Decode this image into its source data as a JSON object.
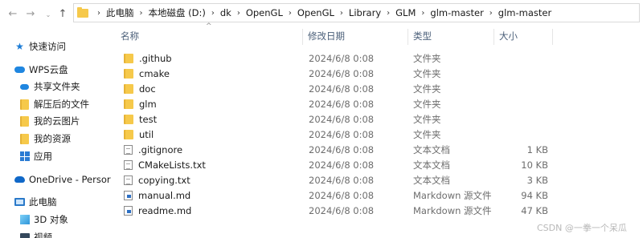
{
  "address_bar": {
    "breadcrumbs": [
      "此电脑",
      "本地磁盘 (D:)",
      "dk",
      "OpenGL",
      "OpenGL",
      "Library",
      "GLM",
      "glm-master",
      "glm-master"
    ]
  },
  "sidebar": {
    "items": [
      {
        "label": "快速访问",
        "icon": "star-icon"
      },
      {
        "label": "WPS云盘",
        "icon": "cloud-icon"
      },
      {
        "label": "共享文件夹",
        "icon": "folder-icon"
      },
      {
        "label": "解压后的文件",
        "icon": "folder-icon"
      },
      {
        "label": "我的云图片",
        "icon": "folder-icon"
      },
      {
        "label": "我的资源",
        "icon": "folder-icon"
      },
      {
        "label": "应用",
        "icon": "apps-icon"
      },
      {
        "label": "OneDrive - Persor",
        "icon": "onedrive-icon"
      },
      {
        "label": "此电脑",
        "icon": "pc-icon"
      },
      {
        "label": "3D 对象",
        "icon": "3d-objects-icon"
      },
      {
        "label": "视频",
        "icon": "video-icon"
      }
    ]
  },
  "columns": {
    "name": "名称",
    "modified": "修改日期",
    "type": "类型",
    "size": "大小"
  },
  "files": [
    {
      "name": ".github",
      "modified": "2024/6/8 0:08",
      "type": "文件夹",
      "size": "",
      "icon": "folder-icon"
    },
    {
      "name": "cmake",
      "modified": "2024/6/8 0:08",
      "type": "文件夹",
      "size": "",
      "icon": "folder-icon"
    },
    {
      "name": "doc",
      "modified": "2024/6/8 0:08",
      "type": "文件夹",
      "size": "",
      "icon": "folder-icon"
    },
    {
      "name": "glm",
      "modified": "2024/6/8 0:08",
      "type": "文件夹",
      "size": "",
      "icon": "folder-icon"
    },
    {
      "name": "test",
      "modified": "2024/6/8 0:08",
      "type": "文件夹",
      "size": "",
      "icon": "folder-icon"
    },
    {
      "name": "util",
      "modified": "2024/6/8 0:08",
      "type": "文件夹",
      "size": "",
      "icon": "folder-icon"
    },
    {
      "name": ".gitignore",
      "modified": "2024/6/8 0:08",
      "type": "文本文档",
      "size": "1 KB",
      "icon": "text-file-icon"
    },
    {
      "name": "CMakeLists.txt",
      "modified": "2024/6/8 0:08",
      "type": "文本文档",
      "size": "10 KB",
      "icon": "text-file-icon"
    },
    {
      "name": "copying.txt",
      "modified": "2024/6/8 0:08",
      "type": "文本文档",
      "size": "3 KB",
      "icon": "text-file-icon"
    },
    {
      "name": "manual.md",
      "modified": "2024/6/8 0:08",
      "type": "Markdown 源文件",
      "size": "94 KB",
      "icon": "markdown-file-icon"
    },
    {
      "name": "readme.md",
      "modified": "2024/6/8 0:08",
      "type": "Markdown 源文件",
      "size": "47 KB",
      "icon": "markdown-file-icon"
    }
  ],
  "watermark": "CSDN @一拳一个呆瓜"
}
